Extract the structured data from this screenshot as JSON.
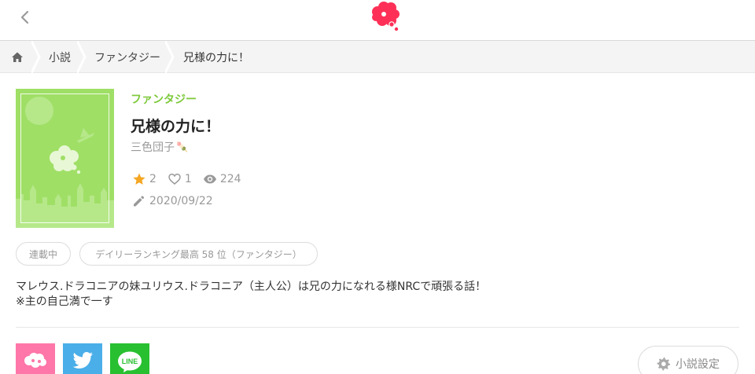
{
  "header": {
    "back_icon": "chevron-left-icon",
    "logo_icon": "cloud-logo-icon",
    "brand_color": "#ff3057"
  },
  "breadcrumb": {
    "home_icon": "home-icon",
    "items": [
      "小説",
      "ファンタジー",
      "兄様の力に！"
    ]
  },
  "novel": {
    "genre": "ファンタジー",
    "title": "兄様の力に！",
    "author": "三色団子",
    "author_emoji": "🍡",
    "stars": "2",
    "likes": "1",
    "views": "224",
    "date": "2020/09/22",
    "tags": [
      "連載中",
      "デイリーランキング最高 58 位（ファンタジー）"
    ],
    "description_lines": [
      "マレウス.ドラコニアの妹ユリウス.ドラコニア（主人公）は兄の力になれる様NRCで頑張る話！",
      "※主の自己満で一す"
    ]
  },
  "share": {
    "buttons": [
      "pink-share-icon",
      "twitter-icon",
      "line-icon"
    ],
    "line_label": "LINE"
  },
  "settings": {
    "label": "小説設定"
  },
  "colors": {
    "genre_green": "#7cc93a",
    "cover_green": "#9fdf66",
    "star_gold": "#f5a623",
    "twitter_blue": "#4aaee8",
    "line_green": "#28c030",
    "pink": "#ff76a8"
  }
}
